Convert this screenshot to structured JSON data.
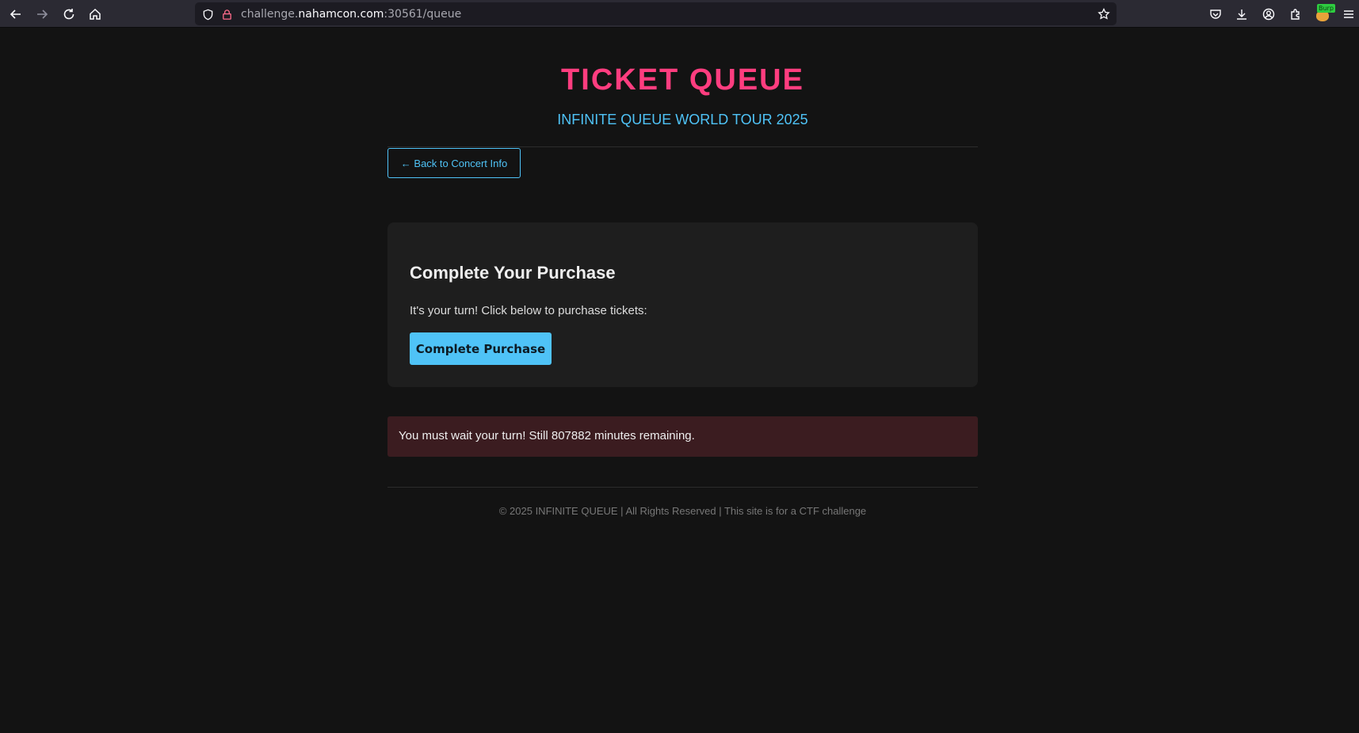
{
  "browser": {
    "url_prefix": "challenge.",
    "url_host": "nahamcon.com",
    "url_suffix": ":30561/queue",
    "burp_badge": "Burp"
  },
  "header": {
    "title": "TICKET QUEUE",
    "subtitle": "INFINITE QUEUE WORLD TOUR 2025"
  },
  "nav": {
    "back_label": "← Back to Concert Info"
  },
  "purchase_card": {
    "heading": "Complete Your Purchase",
    "message": "It's your turn! Click below to purchase tickets:",
    "button_label": "Complete Purchase"
  },
  "error": {
    "message": "You must wait your turn! Still 807882 minutes remaining."
  },
  "footer": {
    "text": "© 2025 INFINITE QUEUE | All Rights Reserved | This site is for a CTF challenge"
  },
  "colors": {
    "accent_pink": "#ff3d7f",
    "accent_blue": "#4fc3f7",
    "error_bg": "#3b1c20",
    "background": "#131313"
  }
}
